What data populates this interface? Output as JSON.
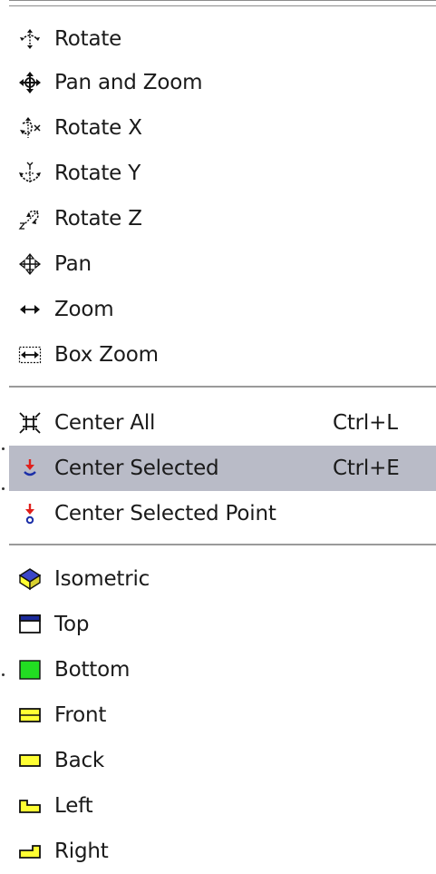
{
  "menu": {
    "items": [
      {
        "label": "Rotate",
        "icon": "rotate-icon"
      },
      {
        "label": "Pan and Zoom",
        "icon": "pan-zoom-icon"
      },
      {
        "label": "Rotate X",
        "icon": "rotate-x-icon"
      },
      {
        "label": "Rotate Y",
        "icon": "rotate-y-icon"
      },
      {
        "label": "Rotate Z",
        "icon": "rotate-z-icon"
      },
      {
        "label": "Pan",
        "icon": "pan-icon"
      },
      {
        "label": "Zoom",
        "icon": "zoom-icon"
      },
      {
        "label": "Box Zoom",
        "icon": "box-zoom-icon"
      },
      {
        "label": "Center All",
        "shortcut": "Ctrl+L",
        "icon": "center-all-icon"
      },
      {
        "label": "Center Selected",
        "shortcut": "Ctrl+E",
        "icon": "center-selected-icon",
        "selected": true
      },
      {
        "label": "Center Selected Point",
        "icon": "center-selected-point-icon"
      },
      {
        "label": "Isometric",
        "icon": "isometric-icon"
      },
      {
        "label": "Top",
        "icon": "top-view-icon"
      },
      {
        "label": "Bottom",
        "icon": "bottom-view-icon"
      },
      {
        "label": "Front",
        "icon": "front-view-icon"
      },
      {
        "label": "Back",
        "icon": "back-view-icon"
      },
      {
        "label": "Left",
        "icon": "left-view-icon"
      },
      {
        "label": "Right",
        "icon": "right-view-icon"
      }
    ]
  },
  "colors": {
    "selection": "#b9bbc7",
    "separator": "#9a9a9a",
    "red_accent": "#e0201c",
    "blue_accent": "#1b2fa8",
    "green_fill": "#22dd22",
    "yellow_fill": "#ffff33"
  }
}
